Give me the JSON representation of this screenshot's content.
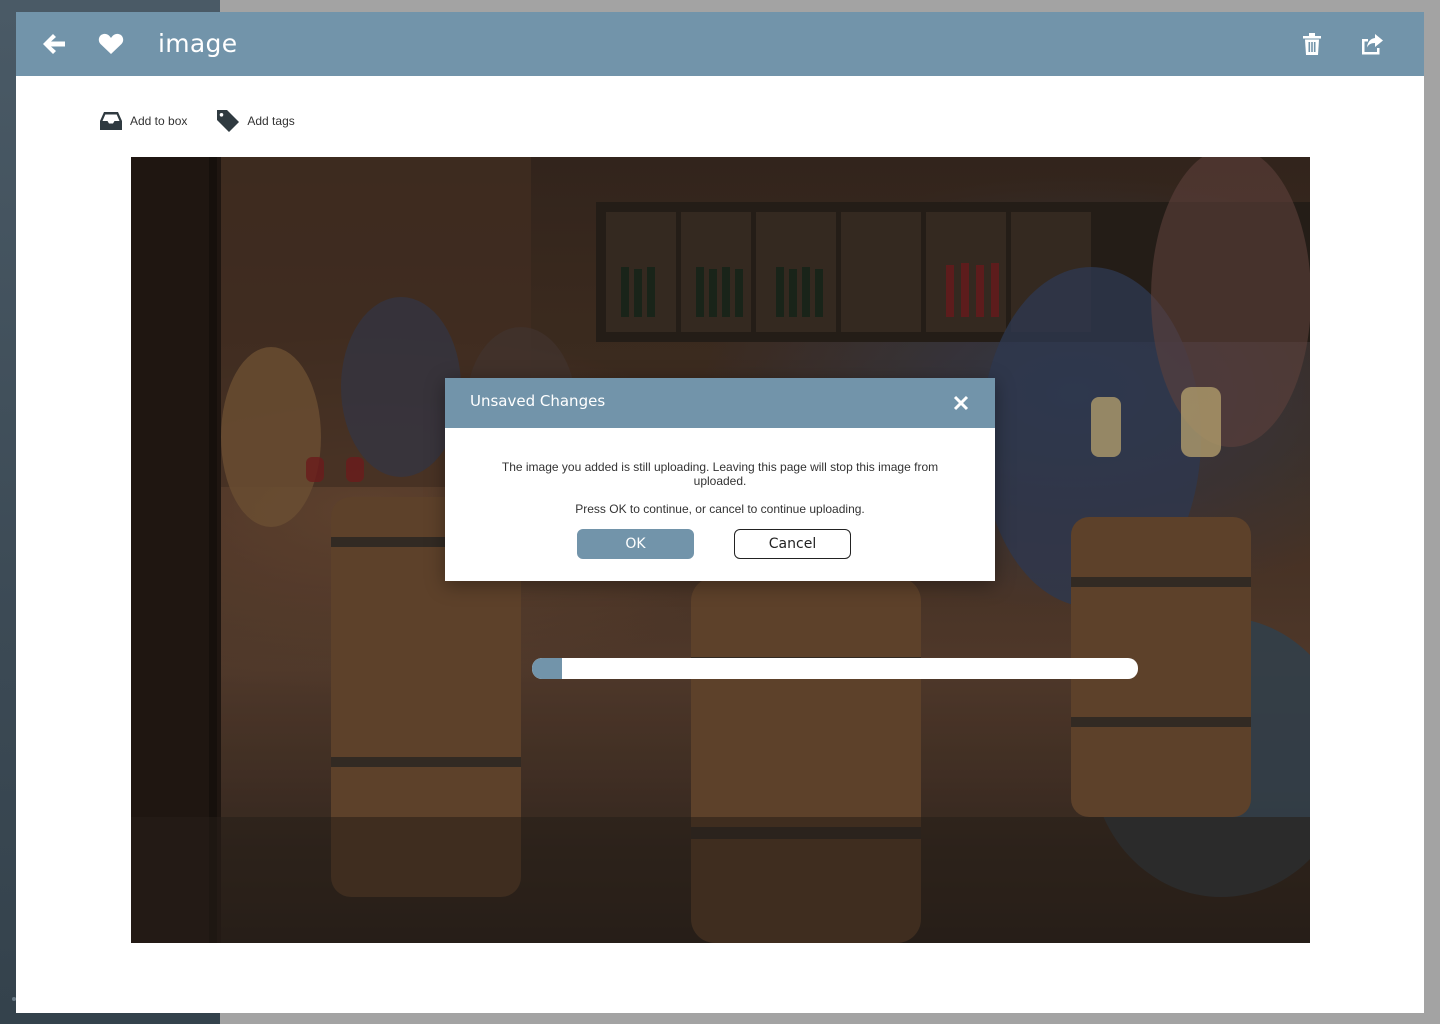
{
  "header": {
    "title": "image",
    "icons": [
      "back-arrow-icon",
      "heart-icon",
      "trash-icon",
      "share-icon"
    ]
  },
  "actions": {
    "add_to_box": "Add to box",
    "add_tags": "Add tags"
  },
  "upload": {
    "progress": 0.05
  },
  "dialog": {
    "title": "Unsaved Changes",
    "message": "The image you added is still uploading. Leaving this page will stop this image from uploaded.",
    "instruction": "Press OK to continue, or cancel to continue uploading.",
    "ok_label": "OK",
    "cancel_label": "Cancel"
  },
  "colors": {
    "accent": "#7294aa",
    "sidebar": "#3f4d58",
    "backdrop": "#a3a3a3"
  }
}
